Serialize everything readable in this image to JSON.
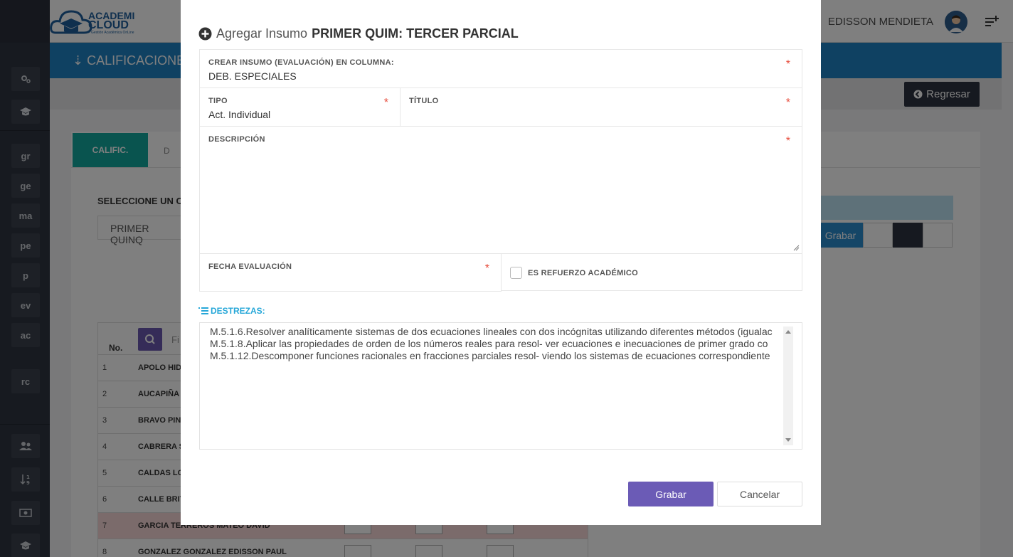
{
  "app": {
    "logo_line1": "ACADEMI",
    "logo_line2": "CLOUD",
    "logo_tagline": "Gestión Académica OnLine",
    "user_name": "EDISSON MENDIETA",
    "section_title": "CALIFICACIONES",
    "regresar_label": "Regresar",
    "sidebar_items": [
      "gr",
      "ge",
      "ma",
      "pe",
      "p",
      "ev",
      "ac",
      "rc"
    ],
    "tabs": {
      "calific_label": "CALIFIC.",
      "other_label": "D"
    },
    "selector_label": "SELECCIONE UN C",
    "selector_value": "PRIMER QUINQ",
    "grabar_label": "Grabar",
    "table": {
      "no_header": "No.",
      "search_placeholder": "Fi",
      "rows": [
        {
          "n": "1",
          "name": "APOLO HID"
        },
        {
          "n": "2",
          "name": "AUCAPIÑA"
        },
        {
          "n": "3",
          "name": "BRAVO PIN"
        },
        {
          "n": "4",
          "name": "CABRERA S"
        },
        {
          "n": "5",
          "name": "CALDAS LO"
        },
        {
          "n": "6",
          "name": "CALLE BRIT"
        },
        {
          "n": "7",
          "name": "GARCIA TERREROS MATEO DAVID"
        },
        {
          "n": "8",
          "name": "GONZALEZ GONZALEZ EDISSON PAUL"
        }
      ]
    },
    "colors": {
      "blue_band": "#1f82c4",
      "teal_tab": "#13a89e",
      "highlight_row": "#f7d7d7"
    }
  },
  "modal": {
    "title_prefix": "Agregar Insumo",
    "title_bold": "PRIMER QUIM: TERCER PARCIAL",
    "columna_label": "CREAR INSUMO (EVALUACIÓN) EN COLUMNA:",
    "columna_value": "DEB. ESPECIALES",
    "tipo_label": "TIPO",
    "tipo_value": "Act. Individual",
    "titulo_label": "TÍTULO",
    "titulo_value": "",
    "descripcion_label": "DESCRIPCIÓN",
    "descripcion_value": "",
    "fecha_label": "FECHA EVALUACIÓN",
    "fecha_value": "",
    "refuerzo_label": "ES REFUERZO ACADÉMICO",
    "refuerzo_checked": false,
    "required_mark": "*",
    "destrezas_label": "DESTREZAS:",
    "destrezas": [
      "M.5.1.6.Resolver analíticamente sistemas de dos ecuaciones lineales con dos incógnitas utilizando diferentes métodos (igualac",
      "M.5.1.8.Aplicar las propiedades de orden de los números reales para resol- ver ecuaciones e inecuaciones de primer grado co",
      "M.5.1.12.Descomponer funciones racionales en fracciones parciales resol- viendo los sistemas de ecuaciones correspondiente"
    ],
    "grabar_label": "Grabar",
    "cancelar_label": "Cancelar",
    "colors": {
      "primary_button": "#6b5bb6",
      "required": "#e74c3c",
      "destrezas_accent": "#26a7d8"
    }
  }
}
